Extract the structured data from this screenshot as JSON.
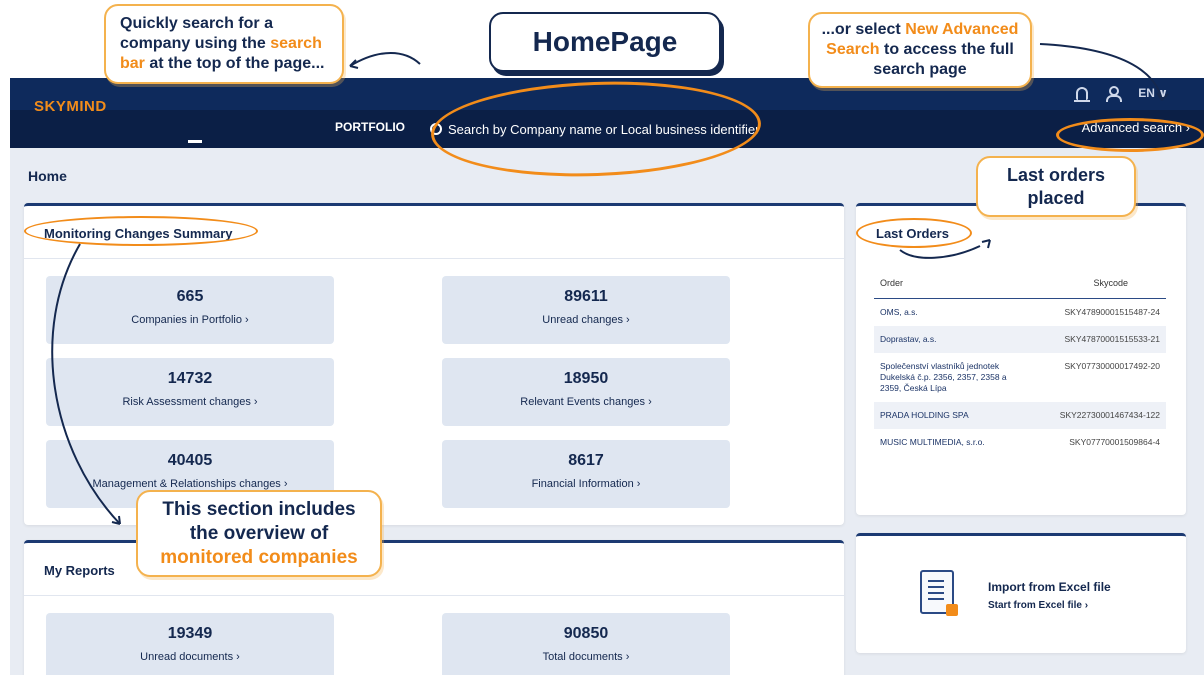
{
  "callouts": {
    "page_title": "HomePage",
    "search_bar_note": {
      "pre": "Quickly search for a company using the ",
      "hl": "search bar",
      "post": " at the top of the page..."
    },
    "advanced_note": {
      "pre": "...or select ",
      "hl": "New Advanced Search",
      "post": " to access the full search page"
    },
    "last_orders_note": "Last orders placed",
    "monitored_note": {
      "pre": "This section includes the overview of ",
      "hl": "monitored companies"
    }
  },
  "header": {
    "logo": "SKYMIND",
    "nav_portfolio": "PORTFOLIO",
    "search_placeholder": "Search by Company name or Local business identifier",
    "language": "EN ∨",
    "advanced_search": "Advanced search ›"
  },
  "page": {
    "title": "Home"
  },
  "monitoring": {
    "title": "Monitoring Changes Summary",
    "tiles": [
      {
        "value": "665",
        "label": "Companies in Portfolio ›"
      },
      {
        "value": "89611",
        "label": "Unread changes ›"
      },
      {
        "value": "14732",
        "label": "Risk Assessment changes ›"
      },
      {
        "value": "18950",
        "label": "Relevant Events changes ›"
      },
      {
        "value": "40405",
        "label": "Management & Relationships changes ›"
      },
      {
        "value": "8617",
        "label": "Financial Information ›"
      }
    ]
  },
  "reports": {
    "title": "My Reports",
    "tiles": [
      {
        "value": "19349",
        "label": "Unread documents ›"
      },
      {
        "value": "90850",
        "label": "Total documents ›"
      }
    ]
  },
  "last_orders": {
    "title": "Last Orders",
    "col_order": "Order",
    "col_skycode": "Skycode",
    "rows": [
      {
        "name": "OMS, a.s.",
        "code": "SKY47890001515487-24"
      },
      {
        "name": "Doprastav, a.s.",
        "code": "SKY47870001515533-21"
      },
      {
        "name": "Společenství vlastníků jednotek Dukelská č.p. 2356, 2357, 2358 a 2359, Česká Lípa",
        "code": "SKY07730000017492-20"
      },
      {
        "name": "PRADA HOLDING SPA",
        "code": "SKY22730001467434-122"
      },
      {
        "name": "MUSIC MULTIMEDIA, s.r.o.",
        "code": "SKY07770001509864-4"
      }
    ]
  },
  "import": {
    "title": "Import from Excel file",
    "link": "Start from Excel file ›"
  },
  "colors": {
    "header": "#0e2a5c",
    "accent": "#f28c1a",
    "tile": "#dfe6f1",
    "text": "#14284f"
  }
}
